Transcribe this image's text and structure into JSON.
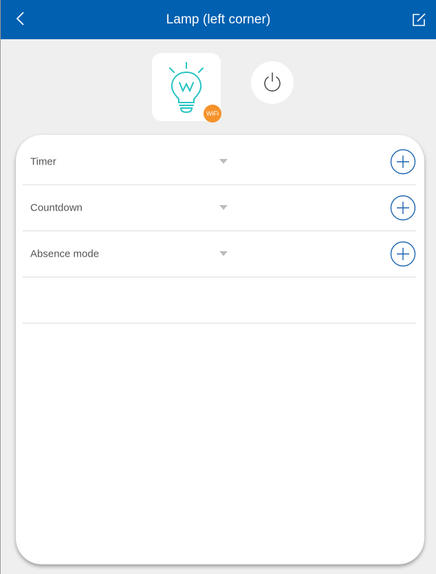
{
  "header": {
    "title": "Lamp  (left corner)",
    "back_icon": "chevron-left-icon",
    "edit_icon": "edit-icon",
    "background": "#0160b0"
  },
  "device": {
    "icon": "lightbulb-icon",
    "badge_label": "WiFi",
    "badge_color": "#f5922b",
    "accent": "#25c4c4",
    "power_icon": "power-icon"
  },
  "schedule": {
    "items": [
      {
        "label": "Timer"
      },
      {
        "label": "Countdown"
      },
      {
        "label": "Absence mode"
      }
    ],
    "add_icon": "plus-circle-icon",
    "dropdown_icon": "caret-down-icon",
    "accent": "#1b64b0"
  }
}
